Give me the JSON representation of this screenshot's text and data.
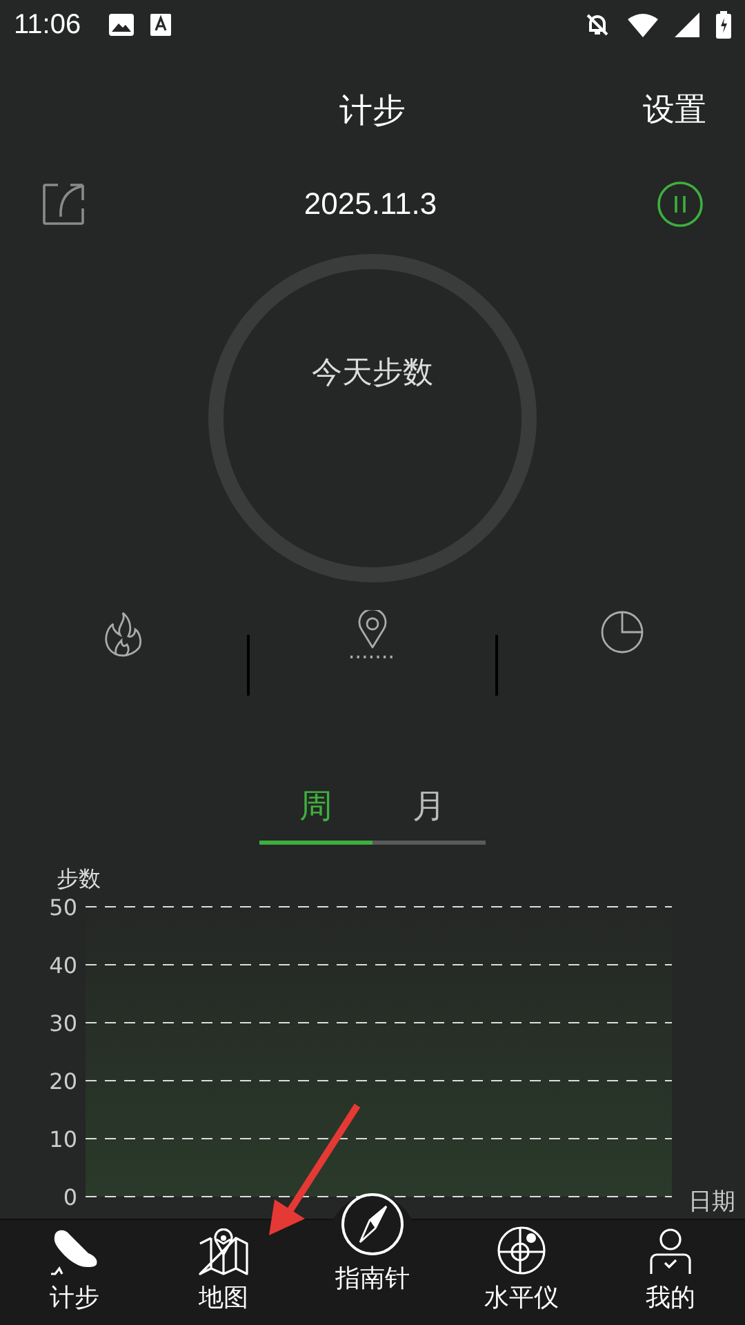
{
  "status_bar": {
    "time": "11:06"
  },
  "header": {
    "title": "计步",
    "settings": "设置"
  },
  "date": "2025.11.3",
  "ring": {
    "label": "今天步数"
  },
  "tabs": [
    {
      "label": "周",
      "selected": true
    },
    {
      "label": "月",
      "selected": false
    }
  ],
  "chart": {
    "chart_data": {
      "type": "area",
      "ylabel": "步数",
      "xlabel": "日期",
      "categories": [
        null,
        null,
        null,
        null,
        null,
        null,
        null
      ],
      "values": [
        null,
        null,
        null,
        null,
        null,
        null,
        null
      ],
      "ylim": [
        0,
        50
      ],
      "yticks": [
        0,
        10,
        20,
        30,
        40,
        50
      ],
      "grid": true
    }
  },
  "nav": [
    {
      "label": "计步",
      "kind": "steps"
    },
    {
      "label": "地图",
      "kind": "map"
    },
    {
      "label": "指南针",
      "kind": "compass"
    },
    {
      "label": "水平仪",
      "kind": "level"
    },
    {
      "label": "我的",
      "kind": "profile"
    }
  ]
}
